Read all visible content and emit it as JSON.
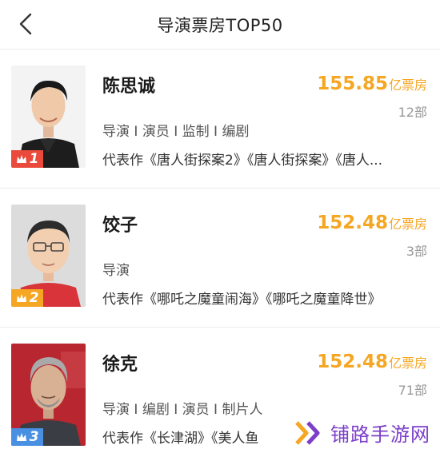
{
  "header": {
    "title": "导演票房TOP50",
    "back_icon": "chevron-left-icon"
  },
  "colors": {
    "gold": "#f5a623",
    "rank1": "#e94a3c",
    "rank2": "#f5a623",
    "rank3": "#4a90e2",
    "watermark": "#7b3fc8"
  },
  "directors": [
    {
      "rank": "1",
      "name": "陈思诚",
      "box_office": "155.85",
      "unit": "亿票房",
      "works": "12部",
      "roles": "导演 I 演员 I 监制 I 编剧",
      "representative": "代表作《唐人街探案2》《唐人街探案》《唐人..."
    },
    {
      "rank": "2",
      "name": "饺子",
      "box_office": "152.48",
      "unit": "亿票房",
      "works": "3部",
      "roles": "导演",
      "representative": "代表作《哪吒之魔童闹海》《哪吒之魔童降世》"
    },
    {
      "rank": "3",
      "name": "徐克",
      "box_office": "152.48",
      "unit": "亿票房",
      "works": "71部",
      "roles": "导演 I 编剧 I 演员 I 制片人",
      "representative": "代表作《长津湖》《美人鱼"
    }
  ],
  "watermark": {
    "text": "铺路手游网"
  }
}
